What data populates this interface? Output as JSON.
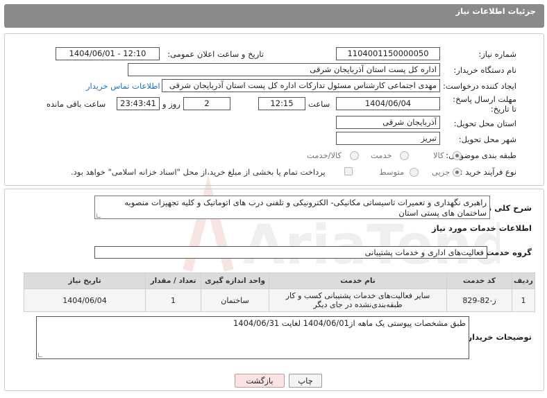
{
  "header": {
    "title": "جزئیات اطلاعات نیاز"
  },
  "form": {
    "need_number_label": "شماره نیاز:",
    "need_number": "1104001150000050",
    "announce_label": "تاریخ و ساعت اعلان عمومی:",
    "announce_value": "1404/06/01 - 12:10",
    "buyer_org_label": "نام دستگاه خریدار:",
    "buyer_org": "اداره کل پست استان آذربایجان شرقی",
    "creator_label": "ایجاد کننده درخواست:",
    "creator": "مهدی اجتماعی کارشناس مسئول تدارکات اداره کل پست استان آذربایجان شرقی",
    "contact_link": "اطلاعات تماس خریدار",
    "deadline_label": "مهلت ارسال پاسخ: تا تاریخ:",
    "deadline_date": "1404/06/04",
    "time_label": "ساعت",
    "deadline_time": "12:15",
    "days_value": "2",
    "days_label": "روز و",
    "remaining_time": "23:43:41",
    "remaining_label": "ساعت باقی مانده",
    "province_label": "استان محل تحویل:",
    "province": "آذربایجان شرقی",
    "city_label": "شهر محل تحویل:",
    "city": "تبریز",
    "category_label": "طبقه بندی موضوعی:",
    "category_options": [
      "کالا",
      "خدمت",
      "کالا/خدمت"
    ],
    "process_label": "نوع فرآیند خرید :",
    "process_options": [
      "جزیی",
      "متوسط"
    ],
    "payment_note": "پرداخت تمام یا بخشی از مبلغ خرید،از محل \"اسناد خزانه اسلامی\" خواهد بود."
  },
  "description": {
    "label": "شرح کلی نیاز:",
    "text": "راهبری  نگهداری و تعمیرات تاسیساتی مکانیکی- الکترونیکی و تلفنی  درب های اتوماتیک و کلیه تجهیزات منصوبه ساختمان های پستی استان"
  },
  "services": {
    "section_title": "اطلاعات خدمات مورد نیاز",
    "group_label": "گروه خدمت:",
    "group_value": "فعالیت‌های اداری و خدمات پشتیبانی",
    "table": {
      "headers": [
        "ردیف",
        "کد خدمت",
        "نام خدمت",
        "واحد اندازه گیری",
        "تعداد / مقدار",
        "تاریخ نیاز"
      ],
      "rows": [
        [
          "1",
          "ز-82-829",
          "سایر فعالیت‌های خدمات پشتیبانی کسب و کار طبقه‌بندی‌نشده در جای دیگر",
          "ساختمان",
          "1",
          "1404/06/04"
        ]
      ]
    }
  },
  "buyer_notes": {
    "label": "توضیحات خریدار:",
    "text": "طبق مشخصات پیوستی یک ماهه از1404/06/01 لغایت 1404/06/31"
  },
  "buttons": {
    "print": "چاپ",
    "back": "بازگشت"
  },
  "watermark": {
    "text": "AriaTender.neT"
  }
}
